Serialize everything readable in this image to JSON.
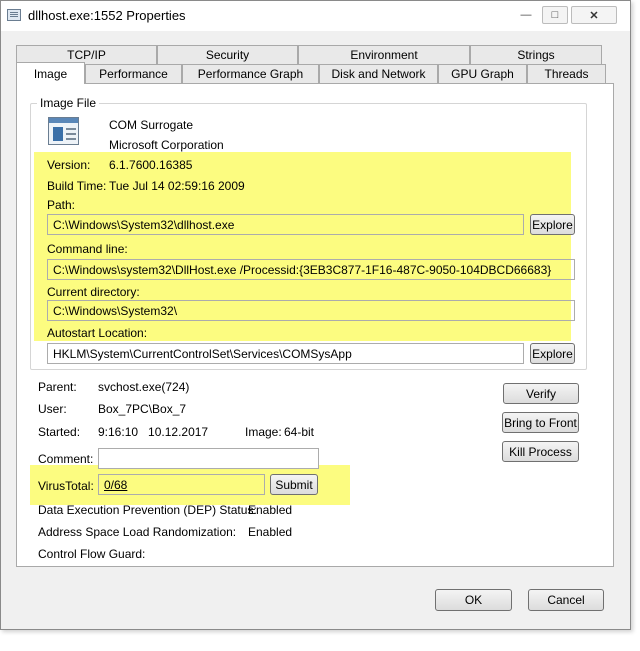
{
  "window": {
    "title": "dllhost.exe:1552 Properties"
  },
  "caption": {
    "minimize": "—",
    "maximize": "□",
    "close": "✕"
  },
  "tabs": {
    "row1": [
      "TCP/IP",
      "Security",
      "Environment",
      "Strings"
    ],
    "row2": [
      "Image",
      "Performance",
      "Performance Graph",
      "Disk and Network",
      "GPU Graph",
      "Threads"
    ],
    "active": "Image"
  },
  "image_file": {
    "group_title": "Image File",
    "description": "COM Surrogate",
    "company": "Microsoft Corporation",
    "version_label": "Version:",
    "version": "6.1.7600.16385",
    "build_time_label": "Build Time:",
    "build_time": "Tue Jul 14 02:59:16 2009",
    "path_label": "Path:",
    "path": "C:\\Windows\\System32\\dllhost.exe",
    "command_line_label": "Command line:",
    "command_line": "C:\\Windows\\system32\\DllHost.exe /Processid:{3EB3C877-1F16-487C-9050-104DBCD66683}",
    "current_dir_label": "Current directory:",
    "current_dir": "C:\\Windows\\System32\\",
    "autostart_label": "Autostart Location:",
    "autostart": "HKLM\\System\\CurrentControlSet\\Services\\COMSysApp",
    "explore_label": "Explore"
  },
  "process": {
    "parent_label": "Parent:",
    "parent": "svchost.exe(724)",
    "user_label": "User:",
    "user": "Box_7PC\\Box_7",
    "started_label": "Started:",
    "started": "9:16:10   10.12.2017",
    "image_label": "Image:",
    "image": "64-bit",
    "comment_label": "Comment:",
    "comment": "",
    "virustotal_label": "VirusTotal:",
    "virustotal": "0/68",
    "submit_label": "Submit",
    "dep_label": "Data Execution Prevention (DEP) Status:",
    "dep": "Enabled",
    "aslr_label": "Address Space Load Randomization:",
    "aslr": "Enabled",
    "cfg_label": "Control Flow Guard:",
    "cfg": ""
  },
  "actions": {
    "verify": "Verify",
    "bring_to_front": "Bring to Front",
    "kill_process": "Kill Process"
  },
  "footer": {
    "ok": "OK",
    "cancel": "Cancel"
  },
  "colors": {
    "highlight": "#fbfb5c",
    "panel": "#ffffff",
    "chrome": "#f0f0f0"
  }
}
